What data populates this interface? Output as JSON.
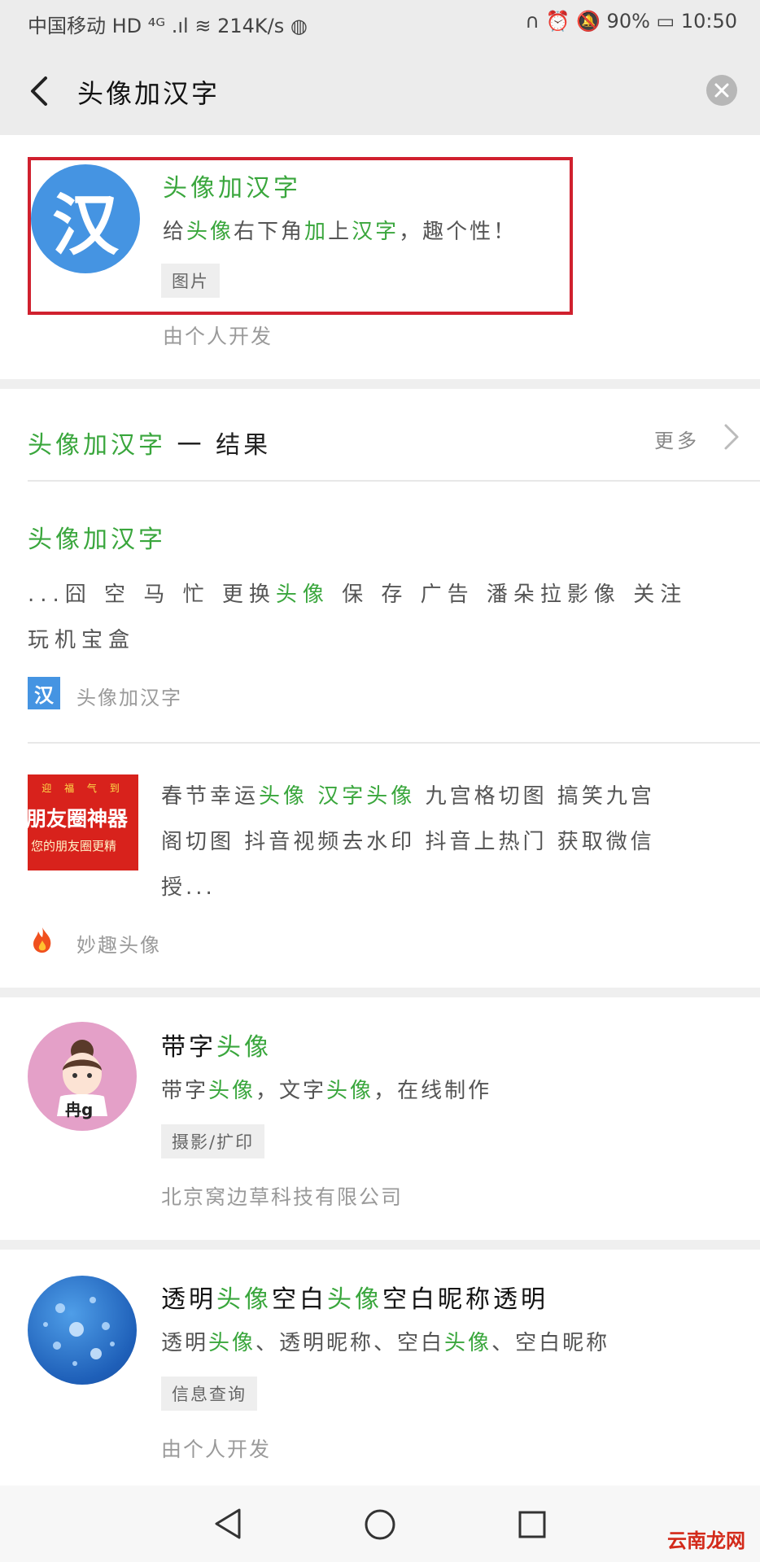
{
  "status_bar": {
    "left": "中国移动 HD ⁴ᴳ .ıl ≋ 214K/s ◍",
    "right": "∩ ⏰ 🔕 90% ▭ 10:50"
  },
  "search": {
    "query": "头像加汉字"
  },
  "top_result": {
    "icon_char": "汉",
    "name": "头像加汉字",
    "desc_parts": [
      "给",
      "头像",
      "右下角",
      "加",
      "上",
      "汉字",
      "，趣个性！"
    ],
    "tag": "图片",
    "developer": "由个人开发"
  },
  "results_section": {
    "title_green": "头像加汉字",
    "title_black": " 一 结果",
    "more_label": "更多"
  },
  "article1": {
    "title": "头像加汉字",
    "line1_parts": [
      "...囧 空 马 忙 更换",
      "头像",
      " 保 存 广告 潘朵拉影像 关注"
    ],
    "line2": "玩机宝盒",
    "source_icon": "汉",
    "source": "头像加汉字"
  },
  "article2": {
    "thumb_top": "迎 福 气 到",
    "thumb_main": "朋友圈神器",
    "thumb_sub": "您的朋友圈更精",
    "line1_parts": [
      "春节幸运",
      "头像",
      " ",
      "汉字头像",
      " 九宫格切图 搞笑九宫"
    ],
    "line2": "阁切图 抖音视频去水印 抖音上热门 获取微信",
    "line3": "授...",
    "source": "妙趣头像"
  },
  "app2": {
    "name_parts": [
      "带字",
      "头像"
    ],
    "desc_parts": [
      "带字",
      "头像",
      "，文字",
      "头像",
      "，在线制作"
    ],
    "tag": "摄影/扩印",
    "developer": "北京窝边草科技有限公司",
    "avatar_text": "冉g"
  },
  "app3": {
    "name_parts": [
      "透明",
      "头像",
      "空白",
      "头像",
      "空白昵称透明"
    ],
    "desc_parts": [
      "透明",
      "头像",
      "、透明昵称、空白",
      "头像",
      "、空白昵称"
    ],
    "tag": "信息查询",
    "developer": "由个人开发"
  },
  "watermark": "云南龙网",
  "colors": {
    "green": "#39a63c",
    "highlight_red": "#d0202e",
    "icon_blue": "#4594e2"
  }
}
